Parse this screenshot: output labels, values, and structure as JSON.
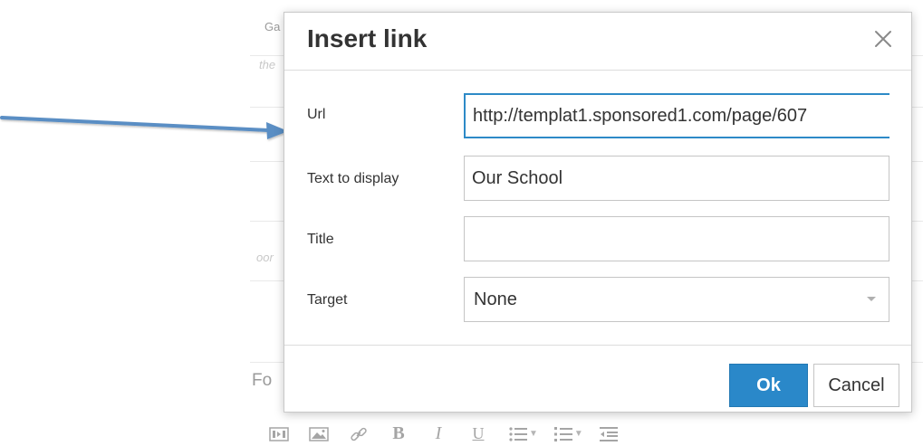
{
  "dialog": {
    "title": "Insert link",
    "fields": {
      "url": {
        "label": "Url",
        "value": "http://templat1.sponsored1.com/page/607"
      },
      "text": {
        "label": "Text to display",
        "value": "Our School"
      },
      "title": {
        "label": "Title",
        "value": ""
      },
      "target": {
        "label": "Target",
        "selected": "None"
      }
    },
    "buttons": {
      "ok": "Ok",
      "cancel": "Cancel"
    }
  },
  "background": {
    "top_fragment": "Ga",
    "italic_fragment_1": "the",
    "italic_fragment_2": "oor",
    "fonts_fragment": "Fo"
  },
  "toolbar": {
    "icons": [
      "media-icon",
      "image-icon",
      "link-icon",
      "bold-icon",
      "italic-icon",
      "underline-icon",
      "bullet-list-icon",
      "numbered-list-icon",
      "outdent-icon"
    ],
    "bold": "B",
    "italic": "I",
    "underline": "U"
  },
  "colors": {
    "primary": "#2a88c9",
    "focus_border": "#2d8ac7",
    "arrow": "#5a8ec4"
  }
}
